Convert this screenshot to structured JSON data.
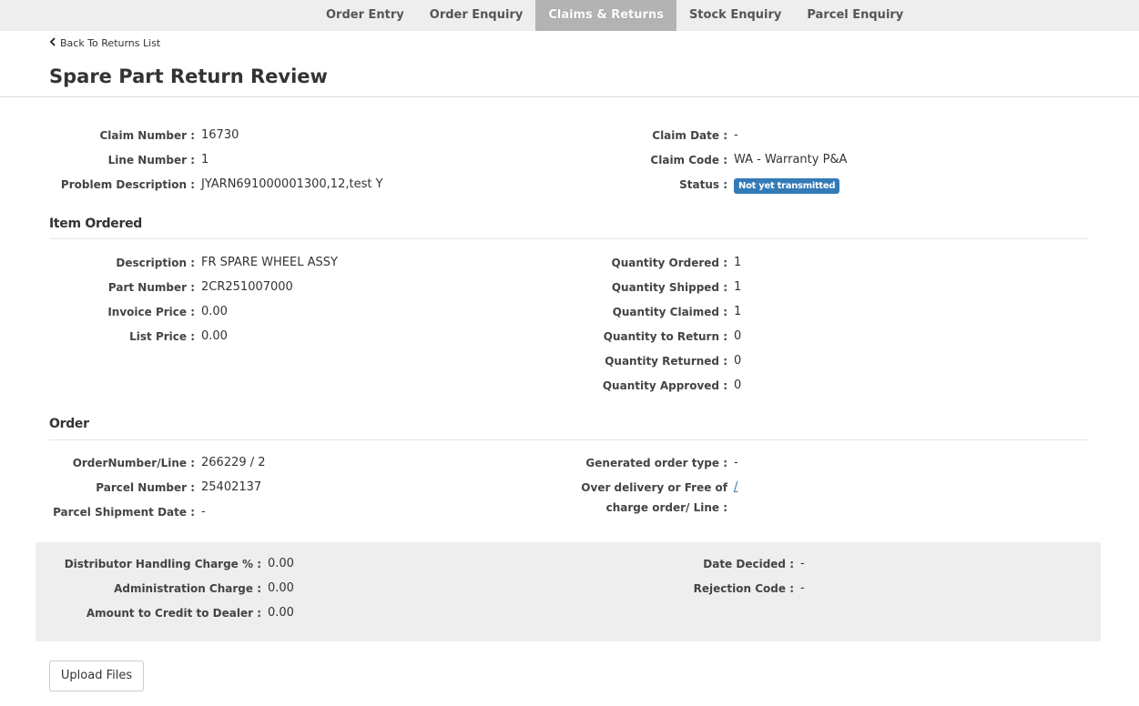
{
  "nav": {
    "tabs": [
      {
        "label": "Order Entry",
        "active": false
      },
      {
        "label": "Order Enquiry",
        "active": false
      },
      {
        "label": "Claims & Returns",
        "active": true
      },
      {
        "label": "Stock Enquiry",
        "active": false
      },
      {
        "label": "Parcel Enquiry",
        "active": false
      }
    ]
  },
  "back_link": {
    "icon": "chevron-left-icon",
    "label": "Back To Returns List"
  },
  "page_title": "Spare Part Return Review",
  "claim": {
    "claim_number": {
      "label": "Claim Number :",
      "value": "16730"
    },
    "line_number": {
      "label": "Line Number :",
      "value": "1"
    },
    "problem_description": {
      "label": "Problem Description :",
      "value": "JYARN691000001300,12,test Y"
    },
    "claim_date": {
      "label": "Claim Date :",
      "value": "-"
    },
    "claim_code": {
      "label": "Claim Code :",
      "value": "WA - Warranty P&A"
    },
    "status": {
      "label": "Status :",
      "value": "Not yet transmitted",
      "color": "#337ab7"
    }
  },
  "item_ordered": {
    "title": "Item Ordered",
    "description": {
      "label": "Description :",
      "value": "FR SPARE WHEEL ASSY"
    },
    "part_number": {
      "label": "Part Number :",
      "value": "2CR251007000"
    },
    "invoice_price": {
      "label": "Invoice Price :",
      "value": "0.00"
    },
    "list_price": {
      "label": "List Price :",
      "value": "0.00"
    },
    "quantity_ordered": {
      "label": "Quantity Ordered :",
      "value": "1"
    },
    "quantity_shipped": {
      "label": "Quantity Shipped :",
      "value": "1"
    },
    "quantity_claimed": {
      "label": "Quantity Claimed :",
      "value": "1"
    },
    "quantity_to_return": {
      "label": "Quantity to Return :",
      "value": "0"
    },
    "quantity_returned": {
      "label": "Quantity Returned :",
      "value": "0"
    },
    "quantity_approved": {
      "label": "Quantity Approved :",
      "value": "0"
    }
  },
  "order": {
    "title": "Order",
    "order_number_line": {
      "label": "OrderNumber/Line :",
      "value": "266229 / 2"
    },
    "parcel_number": {
      "label": "Parcel Number :",
      "value": "25402137"
    },
    "parcel_shipment_date": {
      "label": "Parcel Shipment Date :",
      "value": "-"
    },
    "generated_order_type": {
      "label": "Generated order type :",
      "value": "-"
    },
    "over_delivery": {
      "label_line1": "Over delivery or Free of",
      "label_line2": "charge order/ Line :",
      "value": "/"
    }
  },
  "charges": {
    "distributor_handling_charge": {
      "label": "Distributor Handling Charge % :",
      "value": "0.00"
    },
    "administration_charge": {
      "label": "Administration Charge :",
      "value": "0.00"
    },
    "amount_to_credit": {
      "label": "Amount to Credit to Dealer :",
      "value": "0.00"
    },
    "date_decided": {
      "label": "Date Decided :",
      "value": "-"
    },
    "rejection_code": {
      "label": "Rejection Code :",
      "value": "-"
    }
  },
  "actions": {
    "upload_label": "Upload Files"
  }
}
